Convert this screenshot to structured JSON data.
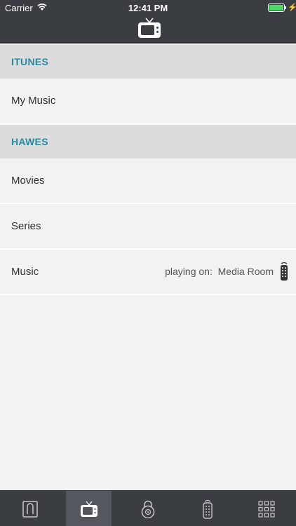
{
  "status_bar": {
    "carrier": "Carrier",
    "time": "12:41 PM",
    "battery_color": "#4cd964",
    "wifi_icon": "wifi-icon",
    "charging_icon": "bolt-icon"
  },
  "header": {
    "icon": "tv-icon"
  },
  "sections": [
    {
      "title": "ITUNES",
      "items": [
        {
          "label": "My Music"
        }
      ]
    },
    {
      "title": "HAWES",
      "items": [
        {
          "label": "Movies"
        },
        {
          "label": "Series"
        },
        {
          "label": "Music",
          "playing_prefix": "playing on:",
          "playing_room": "Media Room",
          "icon": "remote-icon"
        }
      ]
    }
  ],
  "tabbar": {
    "tabs": [
      {
        "icon": "home-icon",
        "active": false
      },
      {
        "icon": "tv-icon",
        "active": true
      },
      {
        "icon": "lock-icon",
        "active": false
      },
      {
        "icon": "remote-icon",
        "active": false
      },
      {
        "icon": "grid-icon",
        "active": false
      }
    ]
  },
  "colors": {
    "bar_background": "#3a3d42",
    "active_tab": "#54575d",
    "section_header_text": "#2a8aa0",
    "section_header_bg": "#dcdcdc",
    "list_bg": "#f2f2f2"
  }
}
